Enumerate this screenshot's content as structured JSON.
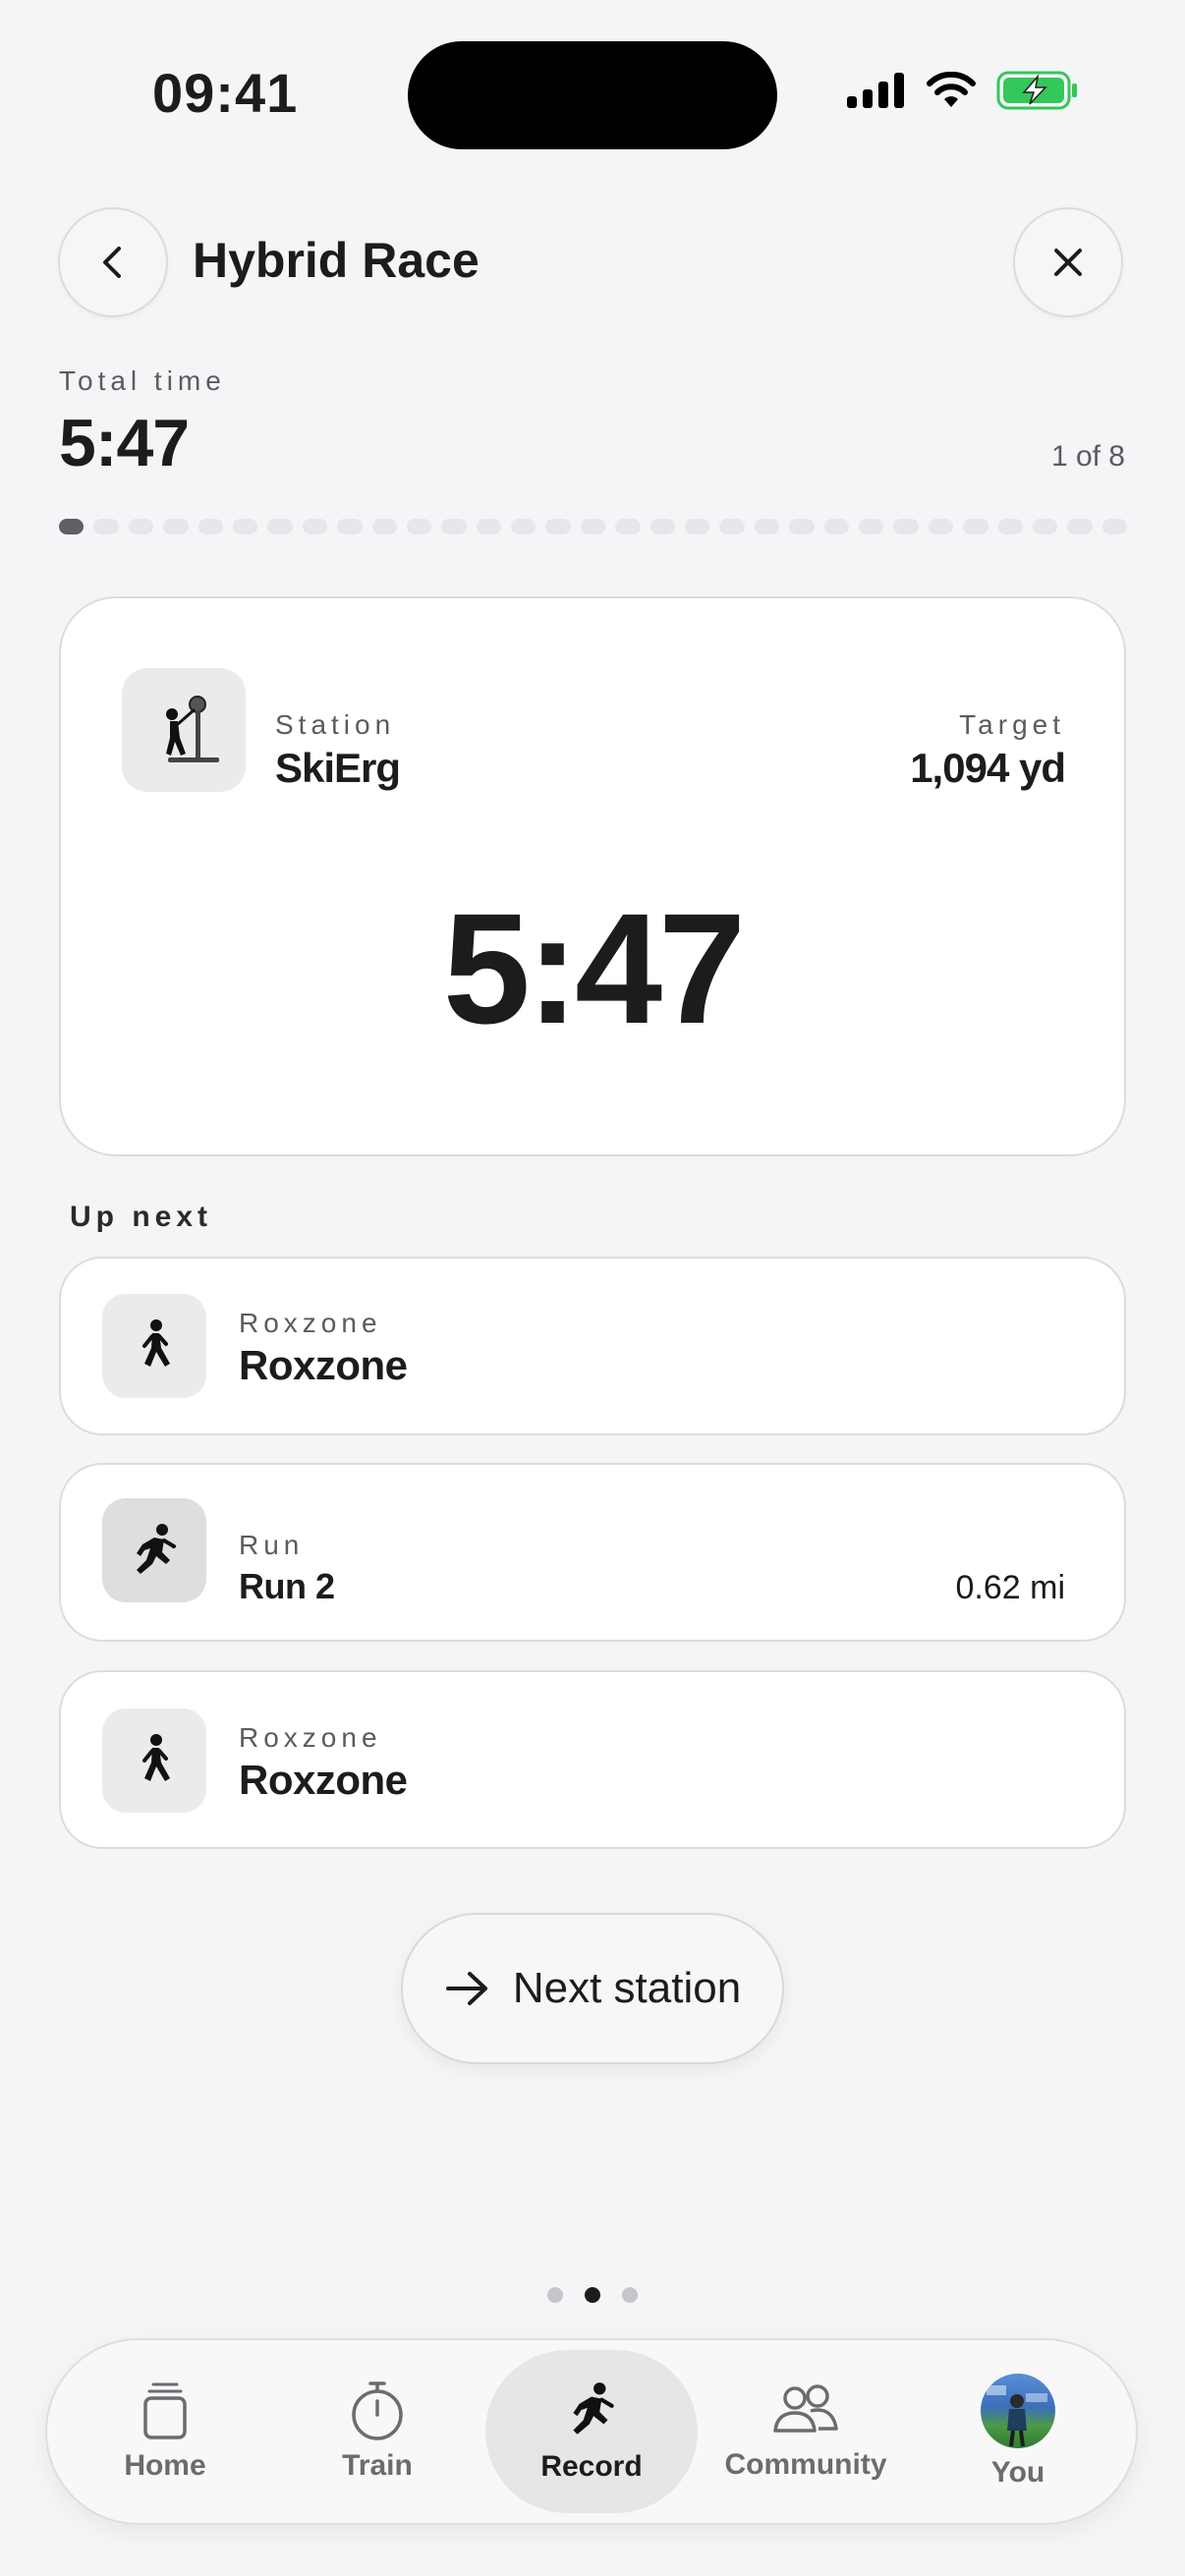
{
  "status_bar": {
    "time": "09:41"
  },
  "header": {
    "title": "Hybrid Race"
  },
  "summary": {
    "total_time_label": "Total time",
    "total_time": "5:47",
    "progress_text": "1 of 8",
    "segments_total": 31,
    "segments_active": 1
  },
  "current": {
    "station_label": "Station",
    "station_name": "SkiErg",
    "target_label": "Target",
    "target_value": "1,094 yd",
    "timer": "5:47",
    "icon": "skierg-icon"
  },
  "up_next": {
    "label": "Up next",
    "items": [
      {
        "type_label": "Roxzone",
        "name": "Roxzone",
        "value": "",
        "icon": "walk-icon"
      },
      {
        "type_label": "Run",
        "name": "Run 2",
        "value": "0.62 mi",
        "icon": "run-icon"
      },
      {
        "type_label": "Roxzone",
        "name": "Roxzone",
        "value": "",
        "icon": "walk-icon"
      }
    ]
  },
  "next_button": {
    "label": "Next station"
  },
  "page_dots": {
    "count": 3,
    "active": 1
  },
  "tabs": [
    {
      "label": "Home",
      "icon": "home-icon"
    },
    {
      "label": "Train",
      "icon": "stopwatch-icon"
    },
    {
      "label": "Record",
      "icon": "run-icon",
      "active": true
    },
    {
      "label": "Community",
      "icon": "people-icon"
    },
    {
      "label": "You",
      "icon": "avatar"
    }
  ],
  "colors": {
    "background": "#f4f5f7",
    "text": "#1c1c1e",
    "muted": "#5b5b5f",
    "battery": "#34c759"
  }
}
